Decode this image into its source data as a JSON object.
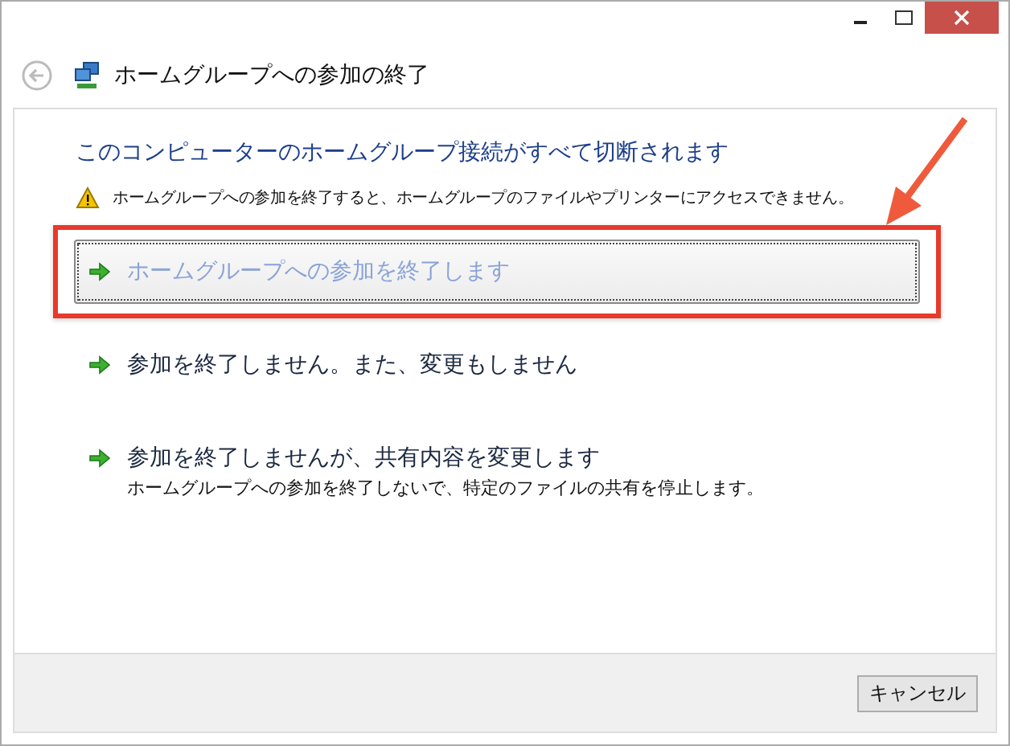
{
  "window": {
    "title": "ホームグループへの参加の終了"
  },
  "heading": "このコンピューターのホームグループ接続がすべて切断されます",
  "warning": "ホームグループへの参加を終了すると、ホームグループのファイルやプリンターにアクセスできません。",
  "options": [
    {
      "label": "ホームグループへの参加を終了します",
      "selected": true
    },
    {
      "label": "参加を終了しません。また、変更もしません",
      "selected": false
    },
    {
      "label": "参加を終了しませんが、共有内容を変更します",
      "description": "ホームグループへの参加を終了しないで、特定のファイルの共有を停止します。",
      "selected": false
    }
  ],
  "buttons": [
    "キャンセル"
  ]
}
